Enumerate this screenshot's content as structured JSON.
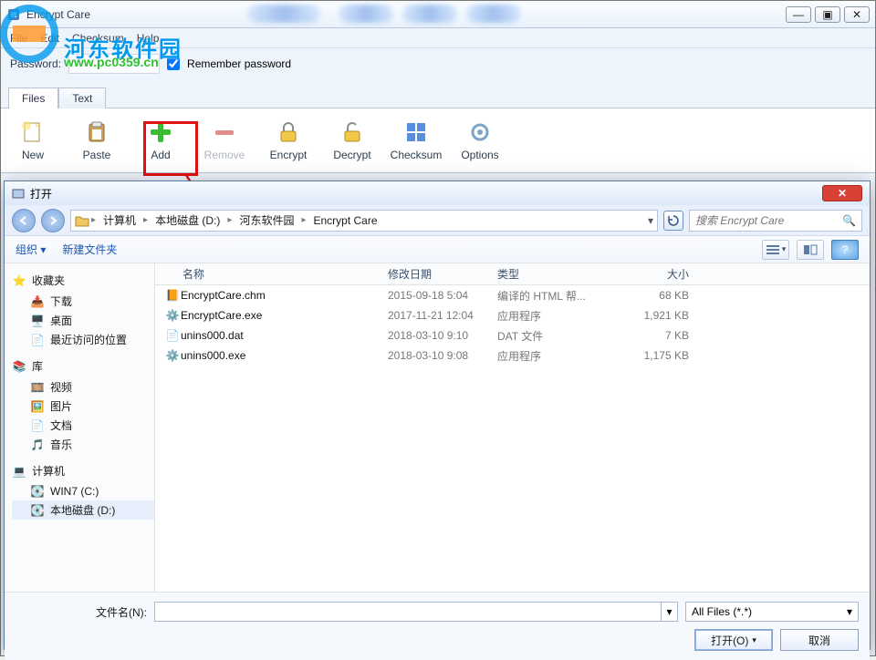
{
  "app": {
    "title": "Encrypt Care",
    "menus": [
      "File",
      "Edit",
      "Checksum",
      "Help"
    ],
    "password_label": "Password:",
    "remember_label": "Remember password",
    "remember_checked": true,
    "tabs": {
      "files": "Files",
      "text": "Text",
      "active": "files"
    },
    "toolbar": [
      {
        "id": "new",
        "label": "New"
      },
      {
        "id": "paste",
        "label": "Paste"
      },
      {
        "id": "add",
        "label": "Add",
        "highlighted": true
      },
      {
        "id": "remove",
        "label": "Remove",
        "disabled": true
      },
      {
        "id": "encrypt",
        "label": "Encrypt"
      },
      {
        "id": "decrypt",
        "label": "Decrypt"
      },
      {
        "id": "checksum",
        "label": "Checksum"
      },
      {
        "id": "options",
        "label": "Options"
      }
    ],
    "win_controls": {
      "min": "—",
      "max": "▣",
      "close": "✕"
    }
  },
  "watermark": {
    "text": "河东软件园",
    "url": "www.pc0359.cn"
  },
  "dialog": {
    "title": "打开",
    "breadcrumb": [
      "计算机",
      "本地磁盘 (D:)",
      "河东软件园",
      "Encrypt Care"
    ],
    "search_placeholder": "搜索 Encrypt Care",
    "org": {
      "organize": "组织 ▾",
      "newfolder": "新建文件夹"
    },
    "columns": {
      "name": "名称",
      "date": "修改日期",
      "type": "类型",
      "size": "大小"
    },
    "nav": {
      "favorites": {
        "label": "收藏夹",
        "items": [
          "下载",
          "桌面",
          "最近访问的位置"
        ]
      },
      "libraries": {
        "label": "库",
        "items": [
          "视频",
          "图片",
          "文档",
          "音乐"
        ]
      },
      "computer": {
        "label": "计算机",
        "items": [
          "WIN7 (C:)",
          "本地磁盘 (D:)"
        ]
      }
    },
    "files": [
      {
        "icon": "chm",
        "name": "EncryptCare.chm",
        "date": "2015-09-18 5:04",
        "type": "编译的 HTML 帮...",
        "size": "68 KB"
      },
      {
        "icon": "exe",
        "name": "EncryptCare.exe",
        "date": "2017-11-21 12:04",
        "type": "应用程序",
        "size": "1,921 KB"
      },
      {
        "icon": "dat",
        "name": "unins000.dat",
        "date": "2018-03-10 9:10",
        "type": "DAT 文件",
        "size": "7 KB"
      },
      {
        "icon": "exe",
        "name": "unins000.exe",
        "date": "2018-03-10 9:08",
        "type": "应用程序",
        "size": "1,175 KB"
      }
    ],
    "filename_label": "文件名(N):",
    "filter_label": "All Files (*.*)",
    "open_btn": "打开(O)",
    "cancel_btn": "取消",
    "close_x": "✕"
  }
}
